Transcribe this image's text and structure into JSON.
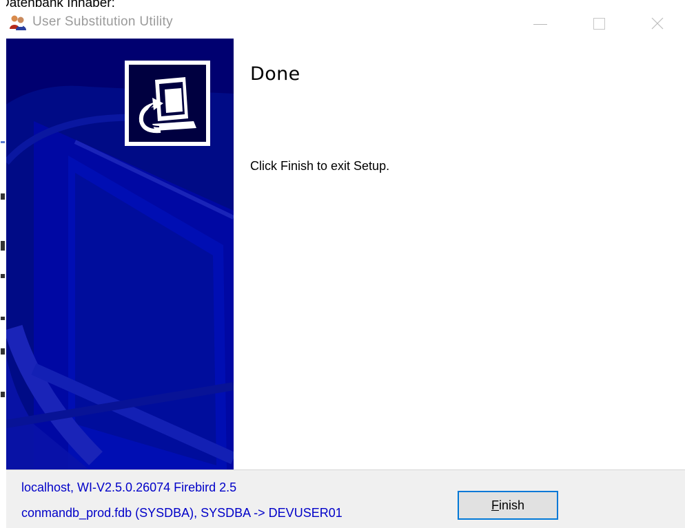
{
  "background": {
    "cropped_text": "Datenbank Inhaber:"
  },
  "window": {
    "title": "User Substitution Utility",
    "controls": {
      "minimize_icon": "minimize-icon",
      "maximize_icon": "maximize-icon",
      "close_icon": "close-icon"
    }
  },
  "banner": {
    "icon": "computer-setup-icon",
    "color": "#000070"
  },
  "content": {
    "heading": "Done",
    "message": "Click Finish to exit Setup."
  },
  "footer": {
    "status_line_1": "localhost, WI-V2.5.0.26074 Firebird 2.5",
    "status_line_2": "conmandb_prod.fdb (SYSDBA), SYSDBA -> DEVUSER01",
    "status_color": "#0000c8",
    "finish_button": {
      "mnemonic": "F",
      "rest": "inish"
    }
  },
  "colors": {
    "accent": "#0078d7",
    "footer_bg": "#f0f0f0"
  }
}
